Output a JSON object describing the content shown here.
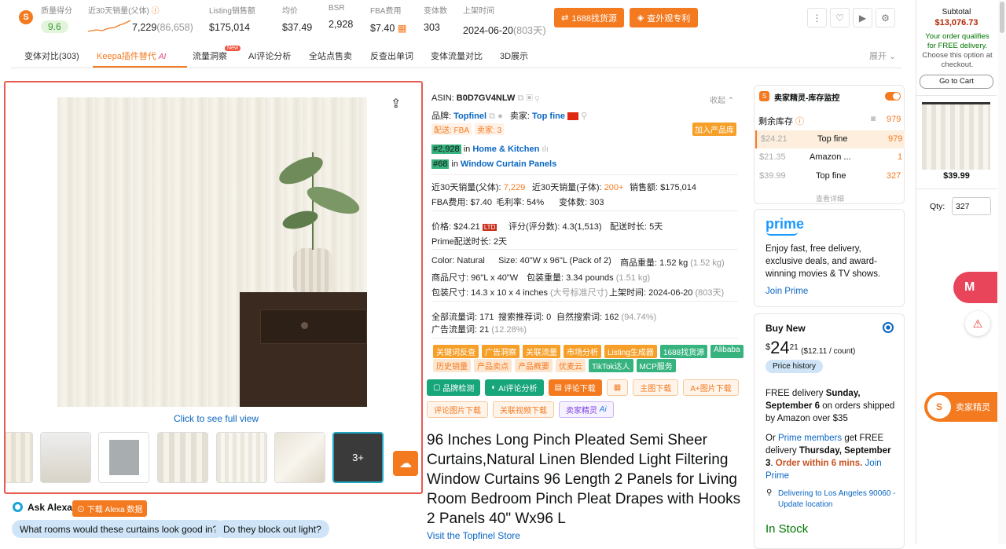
{
  "metrics": {
    "quality": {
      "label": "质量得分",
      "value": "9.6"
    },
    "sales30": {
      "label": "近30天销量(父体)",
      "value": "7,229",
      "sub": "(86,658)"
    },
    "listing": {
      "label": "Listing销售额",
      "value": "$175,014"
    },
    "avgprice": {
      "label": "均价",
      "value": "$37.49"
    },
    "bsr": {
      "label": "BSR",
      "value": "2,928"
    },
    "fba": {
      "label": "FBA费用",
      "value": "$7.40"
    },
    "variants": {
      "label": "变体数",
      "value": "303"
    },
    "listed": {
      "label": "上架时间",
      "value": "2024-06-20",
      "sub": "(803天)"
    }
  },
  "top_buttons": {
    "source1688": "1688找货源",
    "patent": "查外观专利"
  },
  "tabs": [
    "变体对比(303)",
    "Keepa插件替代",
    "流量洞察",
    "AI评论分析",
    "全站点售卖",
    "反查出单词",
    "变体流量对比",
    "3D展示"
  ],
  "tab_badges": {
    "ai": "AI",
    "new": "New"
  },
  "expand": "展开",
  "image": {
    "click_text": "Click to see full view",
    "more": "3+"
  },
  "alexa": {
    "title": "Ask Alexa",
    "download": "下载 Alexa 数据",
    "questions": [
      "What rooms would these curtains look good in?",
      "Do they block out light?"
    ]
  },
  "info": {
    "asin_label": "ASIN:",
    "asin": "B0D7GV4NLW",
    "collapse": "收起",
    "brand_label": "品牌:",
    "brand": "Topfinel",
    "seller_label": "卖家:",
    "seller": "Top fine",
    "fba_tag": "配送: FBA",
    "seller_count": "卖家: 3",
    "add_lib": "加入产品库",
    "rank1": "#2,928",
    "rank1_in": "in",
    "rank1_cat": "Home & Kitchen",
    "rank2": "#68",
    "rank2_in": "in",
    "rank2_cat": "Window Curtain Panels",
    "l1a": "近30天销量(父体):",
    "l1a_v": "7,229",
    "l1b": "近30天销量(子体):",
    "l1b_v": "200+",
    "l1c": "销售额: $175,014",
    "l2": "FBA费用: $7.40",
    "l2b": "毛利率: 54%",
    "l2c": "变体数: 303",
    "l3a": "价格: $24.21",
    "ltd": "LTD",
    "l3b": "评分(评分数): 4.3(1,513)",
    "l3c": "配送时长: 5天",
    "l4": "Prime配送时长: 2天",
    "l5a": "Color:  Natural",
    "l5b": "Size:  40\"W x 96\"L (Pack of 2)",
    "l5c": "商品重量: 1.52 kg",
    "l5c_g": "(1.52 kg)",
    "l6a": "商品尺寸: 96\"L x 40\"W",
    "l6b": "包装重量: 3.34 pounds",
    "l6b_g": "(1.51 kg)",
    "l7a": "包装尺寸: 14.3 x 10 x 4 inches",
    "l7a_g": "(大号标准尺寸)",
    "l7b": "上架时间: 2024-06-20",
    "l7b_g": "(803天)",
    "l8a": "全部流量词: 171",
    "l8b": "搜索推荐词: 0",
    "l8c": "自然搜索词: 162",
    "l8c_g": "(94.74%)",
    "l9": "广告流量词: 21",
    "l9_g": "(12.28%)"
  },
  "tags1": [
    "关键词反查",
    "广告洞察",
    "关联流量",
    "市场分析",
    "Listing生成器",
    "1688找货源",
    "Alibaba"
  ],
  "tags2": [
    "历史销量",
    "产品卖点",
    "产品概要",
    "优麦云",
    "TikTok达人",
    "MCP服务"
  ],
  "actions1": [
    "品牌检测",
    "AI评论分析",
    "评论下载",
    "",
    "主图下载",
    "A+图片下载"
  ],
  "actions2": [
    "评论图片下载",
    "关联视频下载",
    "卖家精灵"
  ],
  "product_title": "96 Inches Long Pinch Pleated Semi Sheer Curtains,Natural Linen Blended Light Filtering Window Curtains 96 Length 2 Panels for Living Room Bedroom Pinch Pleat Drapes with Hooks 2 Panels 40\" Wx96 L",
  "store_link": "Visit the Topfinel Store",
  "stock": {
    "title": "卖家精灵-库存监控",
    "remain": "剩余库存",
    "total": "979",
    "rows": [
      {
        "price": "$24.21",
        "seller": "Top fine",
        "qty": "979"
      },
      {
        "price": "$21.35",
        "seller": "Amazon ...",
        "qty": "1"
      },
      {
        "price": "$39.99",
        "seller": "Top fine",
        "qty": "327"
      }
    ],
    "more": "查看详细"
  },
  "prime": {
    "logo": "prime",
    "text": "Enjoy fast, free delivery, exclusive deals, and award-winning movies & TV shows.",
    "join": "Join Prime"
  },
  "buy": {
    "title": "Buy New",
    "dollar": "$",
    "whole": "24",
    "cents": "21",
    "per": "($12.11 / count)",
    "history": "Price history",
    "d1a": "FREE delivery ",
    "d1b": "Sunday, September 6",
    "d1c": " on orders shipped by Amazon over $35",
    "d2a": "Or ",
    "d2b": "Prime members",
    "d2c": " get FREE delivery ",
    "d2d": "Thursday, September 3",
    "d2e": ". ",
    "d2f": "Order within 6 mins.",
    "d2g": " Join Prime",
    "location": "Delivering to Los Angeles 90060 - Update location",
    "stock": "In Stock"
  },
  "sidebar": {
    "subtotal_label": "Subtotal",
    "subtotal": "$13,076.73",
    "free": "Your order qualifies for FREE delivery.",
    "choose": "Choose this option at checkout.",
    "cart": "Go to Cart",
    "price": "$39.99",
    "qty_label": "Qty:",
    "qty": "327",
    "brand": "卖家精灵"
  },
  "colors": {
    "accent": "#f47a20",
    "link": "#0a66c2",
    "green": "#36b37e",
    "red": "#e85a4f",
    "deal": "#c7511f"
  }
}
